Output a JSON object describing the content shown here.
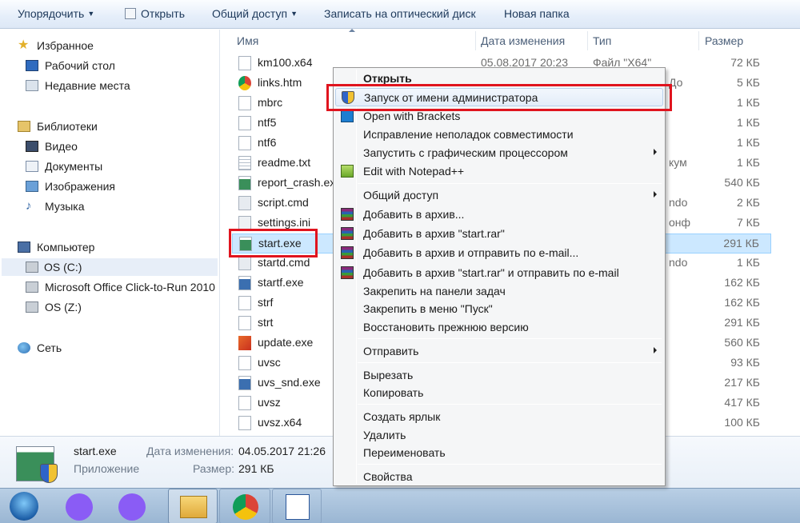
{
  "toolbar": {
    "organize": "Упорядочить",
    "open": "Открыть",
    "share": "Общий доступ",
    "burn": "Записать на оптический диск",
    "new_folder": "Новая папка"
  },
  "nav": {
    "favorites": "Избранное",
    "desktop": "Рабочий стол",
    "recent": "Недавние места",
    "libraries": "Библиотеки",
    "video": "Видео",
    "documents": "Документы",
    "images": "Изображения",
    "music": "Музыка",
    "computer": "Компьютер",
    "drive_c": "OS (C:)",
    "drive_office": "Microsoft Office Click-to-Run 2010",
    "drive_z": "OS (Z:)",
    "network": "Сеть"
  },
  "columns": {
    "name": "Имя",
    "date": "Дата изменения",
    "type": "Тип",
    "size": "Размер"
  },
  "files": [
    {
      "name": "km100.x64",
      "date": "05.08.2017 20:23",
      "type": "Файл \"X64\"",
      "size": "72 КБ",
      "icon": "blank-file-icon"
    },
    {
      "name": "links.htm",
      "date": "",
      "type": "До",
      "size": "5 КБ",
      "icon": "chrome-html-icon"
    },
    {
      "name": "mbrc",
      "date": "",
      "type": "",
      "size": "1 КБ",
      "icon": "blank-file-icon"
    },
    {
      "name": "ntf5",
      "date": "",
      "type": "",
      "size": "1 КБ",
      "icon": "blank-file-icon"
    },
    {
      "name": "ntf6",
      "date": "",
      "type": "",
      "size": "1 КБ",
      "icon": "blank-file-icon"
    },
    {
      "name": "readme.txt",
      "date": "",
      "type": "кум",
      "size": "1 КБ",
      "icon": "text-file-icon"
    },
    {
      "name": "report_crash.exe",
      "date": "",
      "type": "",
      "size": "540 КБ",
      "icon": "exe-icon"
    },
    {
      "name": "script.cmd",
      "date": "",
      "type": "ndo",
      "size": "2 КБ",
      "icon": "cmd-icon"
    },
    {
      "name": "settings.ini",
      "date": "",
      "type": "онф",
      "size": "7 КБ",
      "icon": "ini-icon"
    },
    {
      "name": "start.exe",
      "date": "",
      "type": "",
      "size": "291 КБ",
      "icon": "exe-icon"
    },
    {
      "name": "startd.cmd",
      "date": "",
      "type": "ndo",
      "size": "1 КБ",
      "icon": "cmd-icon"
    },
    {
      "name": "startf.exe",
      "date": "",
      "type": "",
      "size": "162 КБ",
      "icon": "exe-icon"
    },
    {
      "name": "strf",
      "date": "",
      "type": "",
      "size": "162 КБ",
      "icon": "blank-file-icon"
    },
    {
      "name": "strt",
      "date": "",
      "type": "",
      "size": "291 КБ",
      "icon": "blank-file-icon"
    },
    {
      "name": "update.exe",
      "date": "",
      "type": "",
      "size": "560 КБ",
      "icon": "uvs-icon"
    },
    {
      "name": "uvsc",
      "date": "",
      "type": "",
      "size": "93 КБ",
      "icon": "blank-file-icon"
    },
    {
      "name": "uvs_snd.exe",
      "date": "",
      "type": "",
      "size": "217 КБ",
      "icon": "exe-icon"
    },
    {
      "name": "uvsz",
      "date": "",
      "type": "",
      "size": "417 КБ",
      "icon": "blank-file-icon"
    },
    {
      "name": "uvsz.x64",
      "date": "",
      "type": "",
      "size": "100 КБ",
      "icon": "blank-file-icon"
    }
  ],
  "details": {
    "filename": "start.exe",
    "kind": "Приложение",
    "date_label": "Дата изменения:",
    "date_value": "04.05.2017 21:26",
    "size_label": "Размер:",
    "size_value": "291 КБ"
  },
  "context_menu": {
    "open": "Открыть",
    "run_as_admin": "Запуск от имени администратора",
    "open_with_brackets": "Open with Brackets",
    "troubleshoot": "Исправление неполадок совместимости",
    "run_with_gpu": "Запустить с графическим процессором",
    "edit_notepad": "Edit with Notepad++",
    "share": "Общий доступ",
    "add_archive": "Добавить в архив...",
    "add_start_rar": "Добавить в архив \"start.rar\"",
    "add_email": "Добавить в архив и отправить по e-mail...",
    "add_rar_email": "Добавить в архив \"start.rar\" и отправить по e-mail",
    "pin_taskbar": "Закрепить на панели задач",
    "pin_start": "Закрепить в меню \"Пуск\"",
    "restore_prev": "Восстановить прежнюю версию",
    "send_to": "Отправить",
    "cut": "Вырезать",
    "copy": "Копировать",
    "create_shortcut": "Создать ярлык",
    "delete": "Удалить",
    "rename": "Переименовать",
    "properties": "Свойства"
  },
  "colors": {
    "highlight_red": "#e0141e",
    "selection": "#cce8ff",
    "toolbar_text": "#1e395b"
  }
}
